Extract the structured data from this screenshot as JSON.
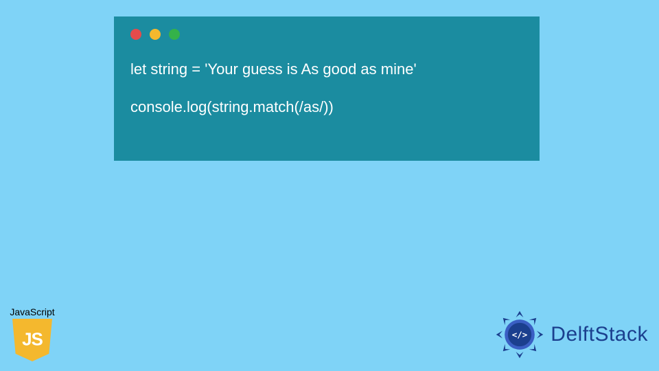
{
  "code": {
    "lines": [
      "let string = 'Your guess is As good as mine'",
      "console.log(string.match(/as/))"
    ]
  },
  "badges": {
    "js_label": "JavaScript",
    "js_shield_text": "JS"
  },
  "brand": {
    "name": "DelftStack"
  },
  "colors": {
    "page_bg": "#7fd3f7",
    "window_bg": "#1b8ca0",
    "dot_red": "#e44b4b",
    "dot_yellow": "#f4b82e",
    "dot_green": "#34b24a",
    "js_shield": "#f4b82e",
    "brand_blue": "#1b3f8e"
  }
}
